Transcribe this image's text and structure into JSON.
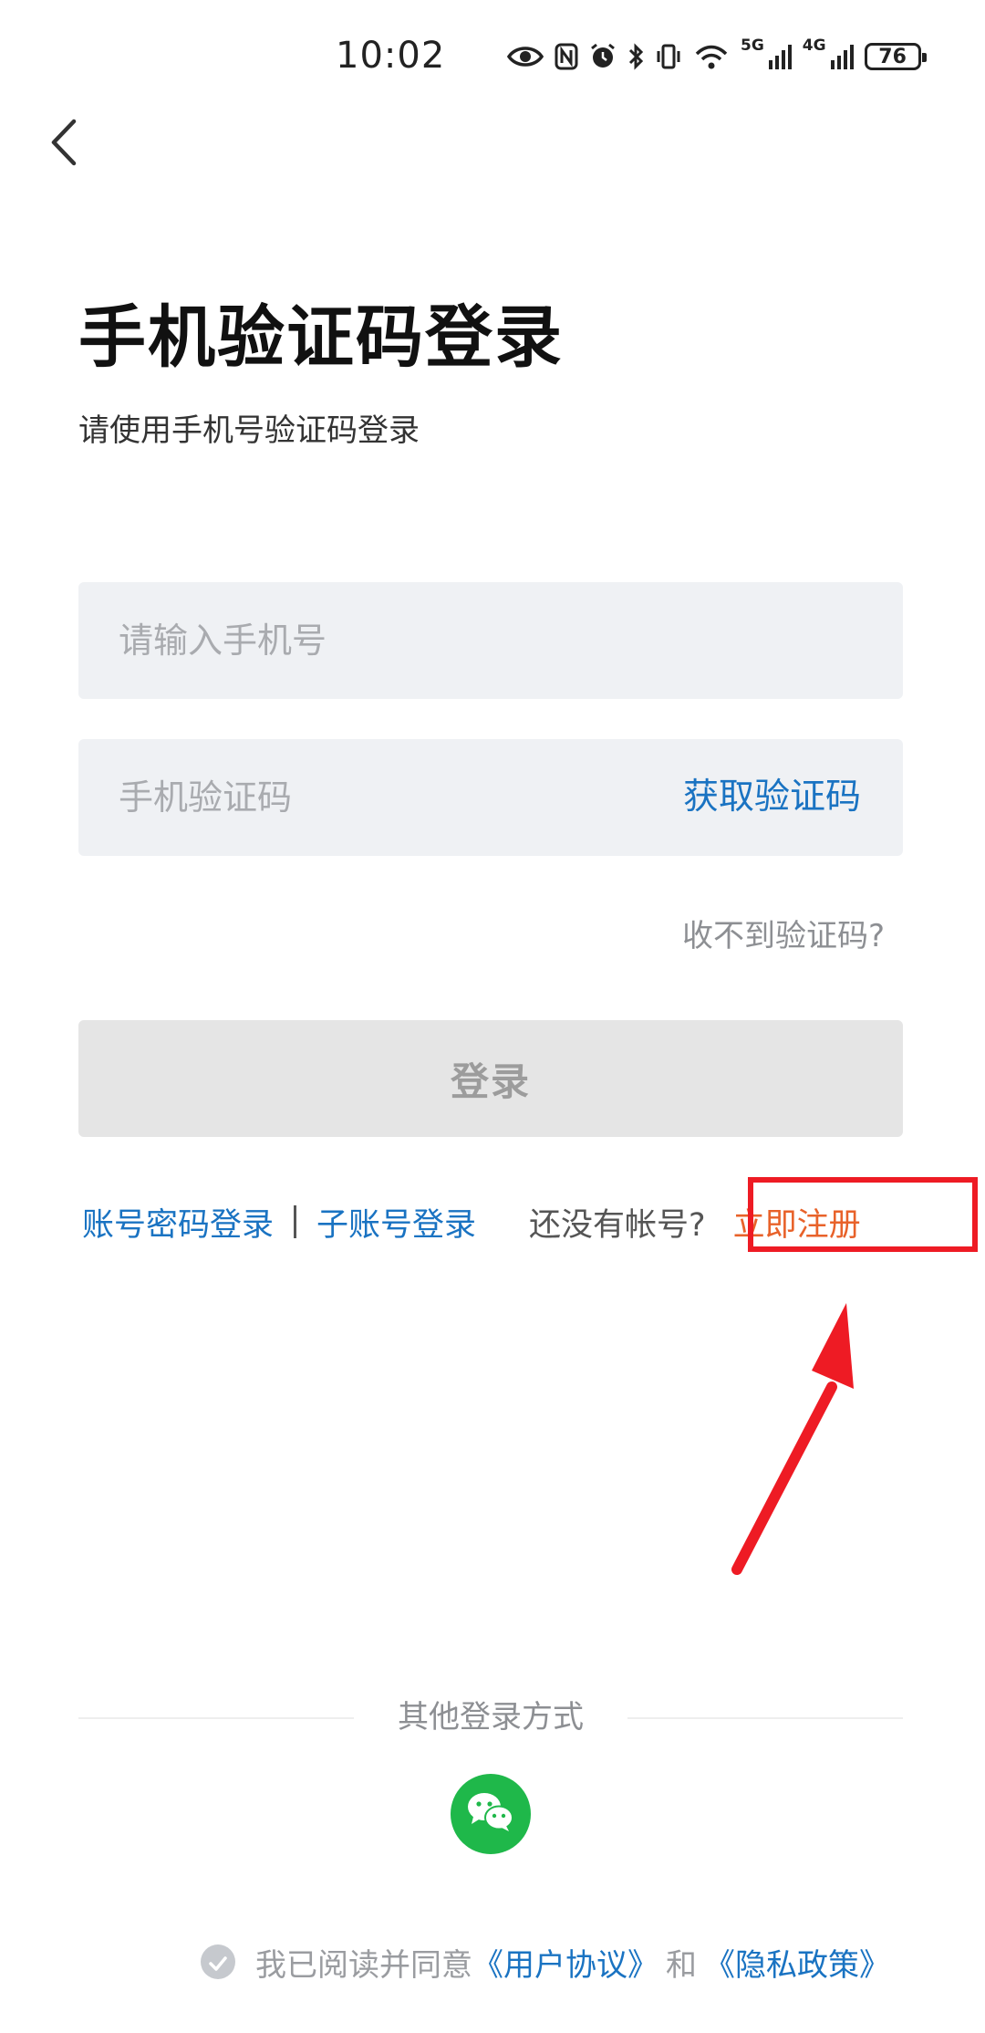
{
  "status_bar": {
    "time": "10:02",
    "signal_5g_label": "5G",
    "signal_4g_label": "4G",
    "battery": "76",
    "icons": [
      "eye-icon",
      "nfc-icon",
      "alarm-icon",
      "bluetooth-icon",
      "vibrate-icon",
      "wifi-icon",
      "signal-5g-icon",
      "signal-4g-icon",
      "battery-icon"
    ]
  },
  "nav": {
    "back_icon": "chevron-left-icon"
  },
  "header": {
    "title": "手机验证码登录",
    "subtitle": "请使用手机号验证码登录"
  },
  "form": {
    "phone_value": "",
    "phone_placeholder": "请输入手机号",
    "code_value": "",
    "code_placeholder": "手机验证码",
    "get_code_label": "获取验证码",
    "no_code_label": "收不到验证码?",
    "login_label": "登录"
  },
  "alt_login": {
    "password_login": "账号密码登录",
    "sub_account_login": "子账号登录",
    "no_account": "还没有帐号?",
    "register": "立即注册"
  },
  "other_login": {
    "label": "其他登录方式",
    "wechat_icon": "wechat-icon"
  },
  "agreement": {
    "prefix": "我已阅读并同意",
    "user_agreement": "《用户协议》",
    "and": "和",
    "privacy_policy": "《隐私政策》",
    "checked": false
  },
  "colors": {
    "link_blue": "#1a73c2",
    "register_orange": "#e8622a",
    "annotation_red": "#ee1b24",
    "wechat_green": "#1fb84a",
    "input_bg": "#eff1f4",
    "disabled_button_bg": "#e5e5e5"
  }
}
